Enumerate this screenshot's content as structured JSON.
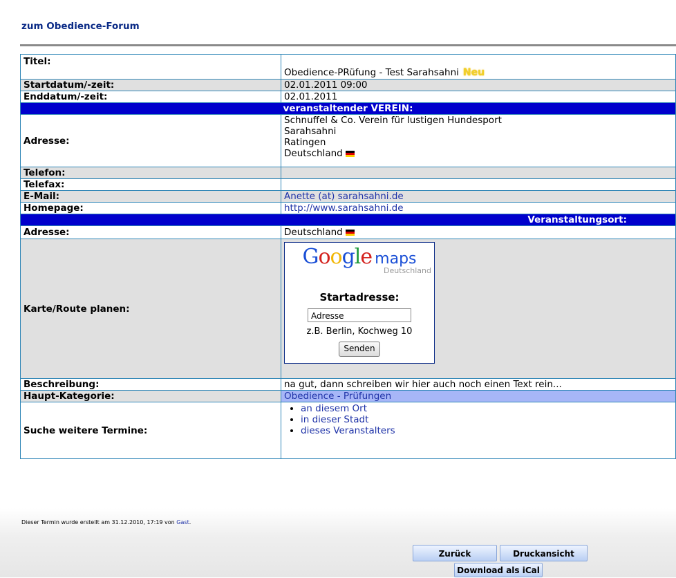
{
  "header": {
    "forum_link": "zum Obedience-Forum"
  },
  "details": {
    "title_label": "Titel:",
    "title_value": "Obedience-PRüfung - Test Sarahsahni",
    "new_badge": "Neu",
    "start_label": "Startdatum/-zeit:",
    "start_value": "02.01.2011 09:00",
    "end_label": "Enddatum/-zeit:",
    "end_value": "02.01.2011",
    "organizer_header": "veranstaltender VEREIN:",
    "org_address_label": "Adresse:",
    "org_address_lines": [
      "Schnuffel & Co. Verein für lustigen Hundesport",
      "Sarahsahni",
      "Ratingen",
      "Deutschland"
    ],
    "phone_label": "Telefon:",
    "fax_label": "Telefax:",
    "email_label": "E-Mail:",
    "email_value": "Anette (at) sarahsahni.de",
    "homepage_label": "Homepage:",
    "homepage_value": "http://www.sarahsahni.de",
    "venue_header": "Veranstaltungsort:",
    "venue_address_label": "Adresse:",
    "venue_address_value": "Deutschland",
    "map_label": "Karte/Route planen:",
    "description_label": "Beschreibung:",
    "description_value": "na gut, dann schreiben wir hier auch noch einen Text rein...",
    "category_label": "Haupt-Kategorie:",
    "category_value": "Obedience - Prüfungen",
    "search_label": "Suche weitere Termine:",
    "search_links": [
      "an diesem Ort",
      "in dieser Stadt",
      "dieses Veranstalters"
    ]
  },
  "map_widget": {
    "logo_google": "Google",
    "logo_maps": "maps",
    "logo_country": "Deutschland",
    "start_heading": "Startadresse:",
    "address_input_value": "Adresse",
    "hint": "z.B. Berlin, Kochweg 10",
    "send_button": "Senden"
  },
  "footer": {
    "created_prefix": "Dieser Termin wurde erstellt am 31.12.2010, 17:19 von",
    "created_by": "Gast",
    "back_button": "Zurück",
    "print_button": "Druckansicht",
    "ical_button": "Download als iCal"
  },
  "colors": {
    "section_header_bg": "#0000cc",
    "row_gray": "#e0e0e0",
    "category_highlight": "#a7b6f7",
    "border": "#2f86b7",
    "link": "#1f33a8"
  },
  "icons": {
    "flag": "german-flag-icon"
  }
}
